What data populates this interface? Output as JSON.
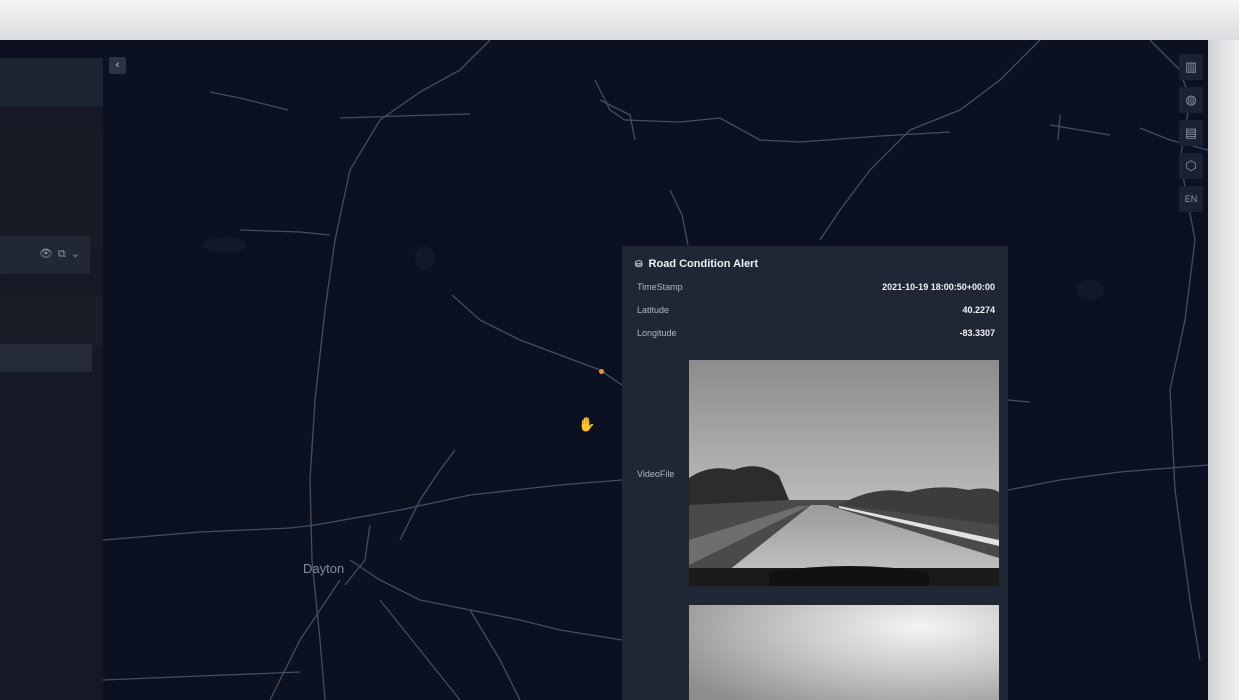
{
  "map": {
    "city_label": "Dayton"
  },
  "left_panel": {
    "row_icons": [
      "eye-icon",
      "copy-icon",
      "chevron-down-icon"
    ]
  },
  "collapse_button": {
    "label": "‹"
  },
  "toolbar": {
    "buttons": [
      {
        "name": "map-layout-icon",
        "glyph": "▥"
      },
      {
        "name": "globe-icon",
        "glyph": "◍"
      },
      {
        "name": "table-icon",
        "glyph": "▤"
      },
      {
        "name": "map-pin-icon",
        "glyph": "⬡"
      },
      {
        "name": "language",
        "glyph": "EN"
      }
    ]
  },
  "popup": {
    "title": "Road Condition Alert",
    "icon": "database-icon",
    "properties": [
      {
        "key": "TimeStamp",
        "value": "2021-10-19 18:00:50+00:00"
      },
      {
        "key": "Latitude",
        "value": "40.2274"
      },
      {
        "key": "Longitude",
        "value": "-83.3307"
      }
    ],
    "video_key": "VideoFile"
  },
  "colors": {
    "map_background": "#0b1120",
    "road": "#5d6a7d",
    "popup_background": "#1f2735",
    "marker": "#e8943b"
  }
}
